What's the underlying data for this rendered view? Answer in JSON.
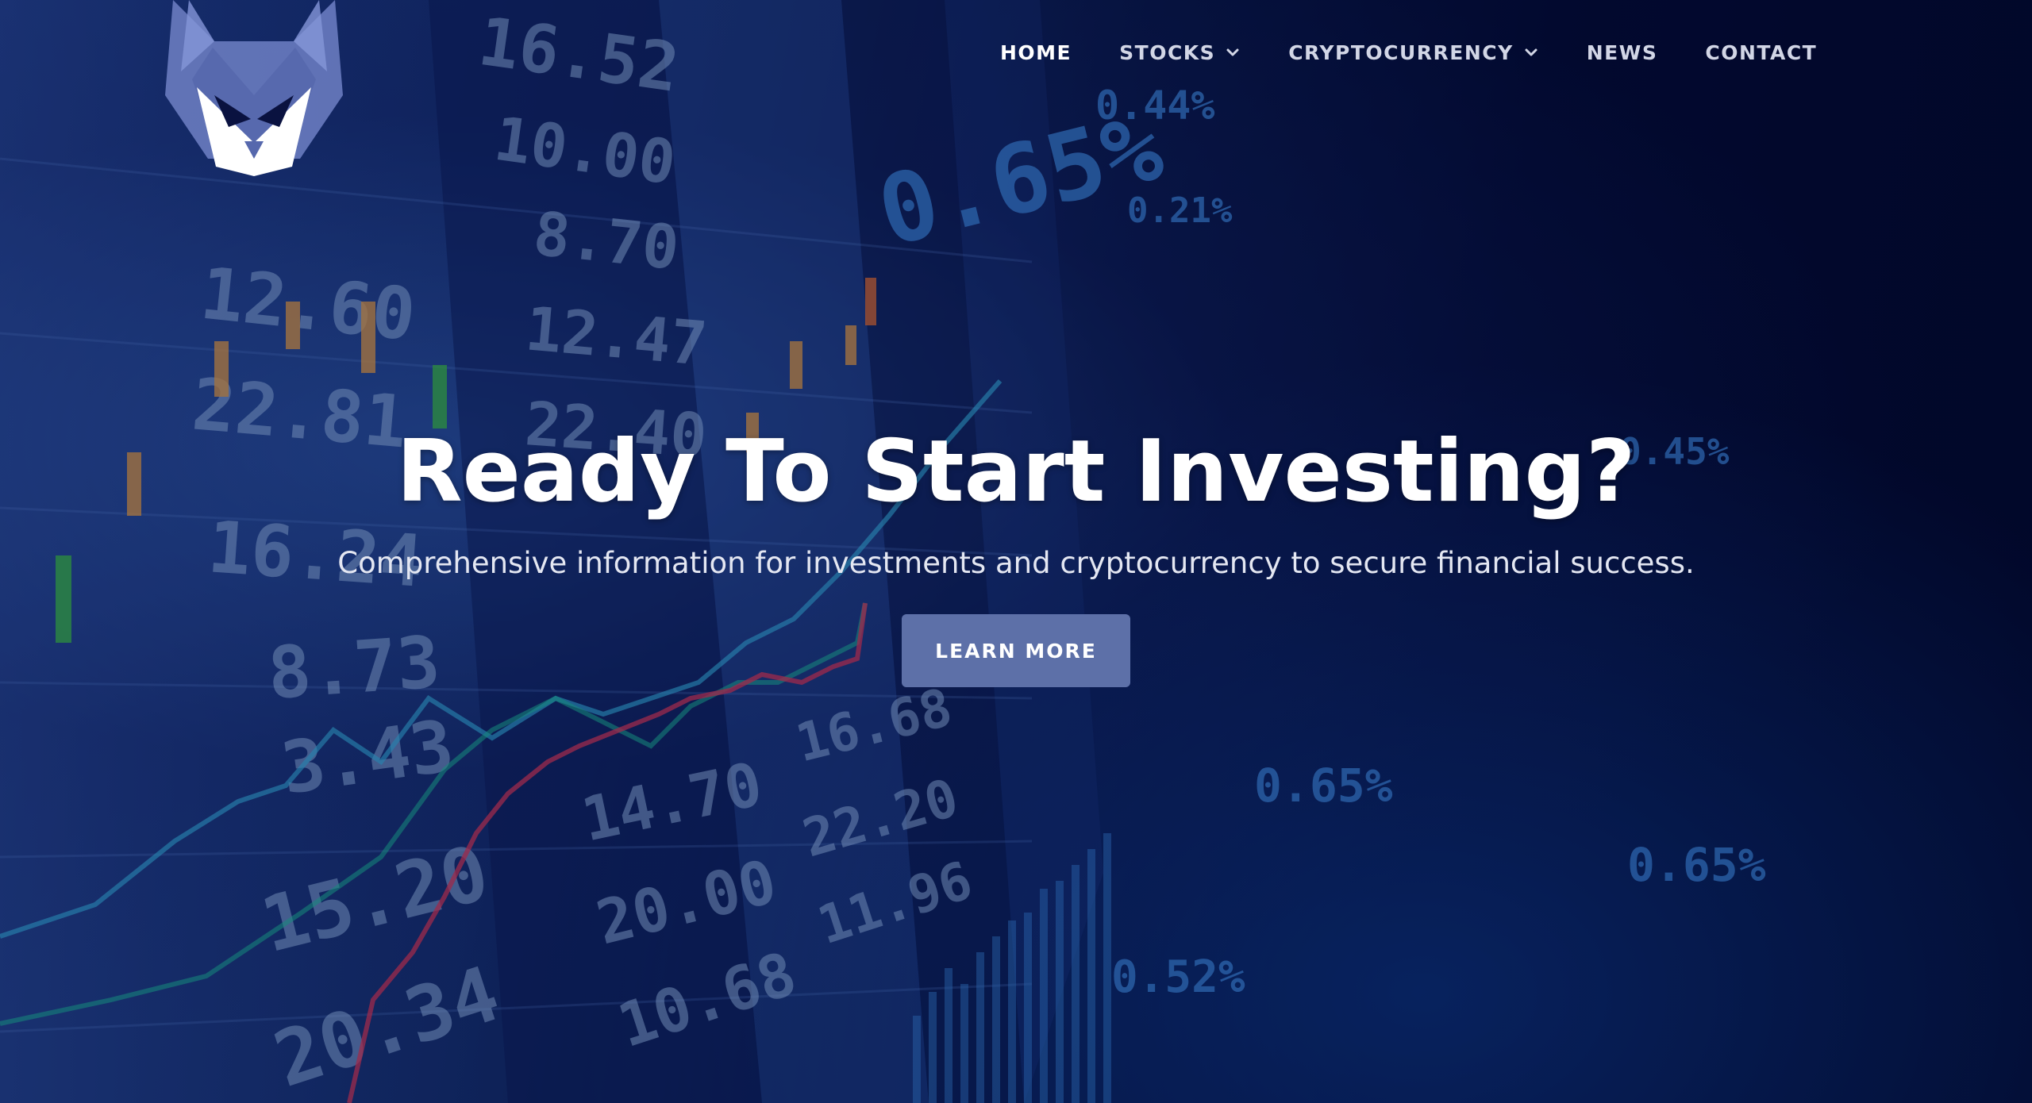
{
  "nav": {
    "items": [
      {
        "label": "HOME",
        "active": true,
        "dropdown": false
      },
      {
        "label": "STOCKS",
        "active": false,
        "dropdown": true
      },
      {
        "label": "CRYPTOCURRENCY",
        "active": false,
        "dropdown": true
      },
      {
        "label": "NEWS",
        "active": false,
        "dropdown": false
      },
      {
        "label": "CONTACT",
        "active": false,
        "dropdown": false
      }
    ]
  },
  "hero": {
    "title": "Ready To Start Investing?",
    "subtitle": "Comprehensive information for investments and cryptocurrency to secure financial success.",
    "cta_label": "LEARN MORE"
  },
  "background": {
    "board_numbers": [
      "16.52",
      "10.00",
      "8.70",
      "12.47",
      "22.40",
      "12.60",
      "22.81",
      "16.24",
      "8.73",
      "3.43",
      "15.20",
      "20.34",
      "14.70",
      "20.00",
      "10.68",
      "16.68",
      "22.20",
      "11.96",
      "0.65%",
      "0.44%",
      "0.21%",
      "0.45%",
      "0.52%"
    ]
  },
  "colors": {
    "background": "#020a2e",
    "accent_button": "#5d70a8",
    "logo": "#6f80c4"
  },
  "icons": {
    "logo": "fox-head-icon",
    "dropdown": "chevron-down-icon"
  }
}
